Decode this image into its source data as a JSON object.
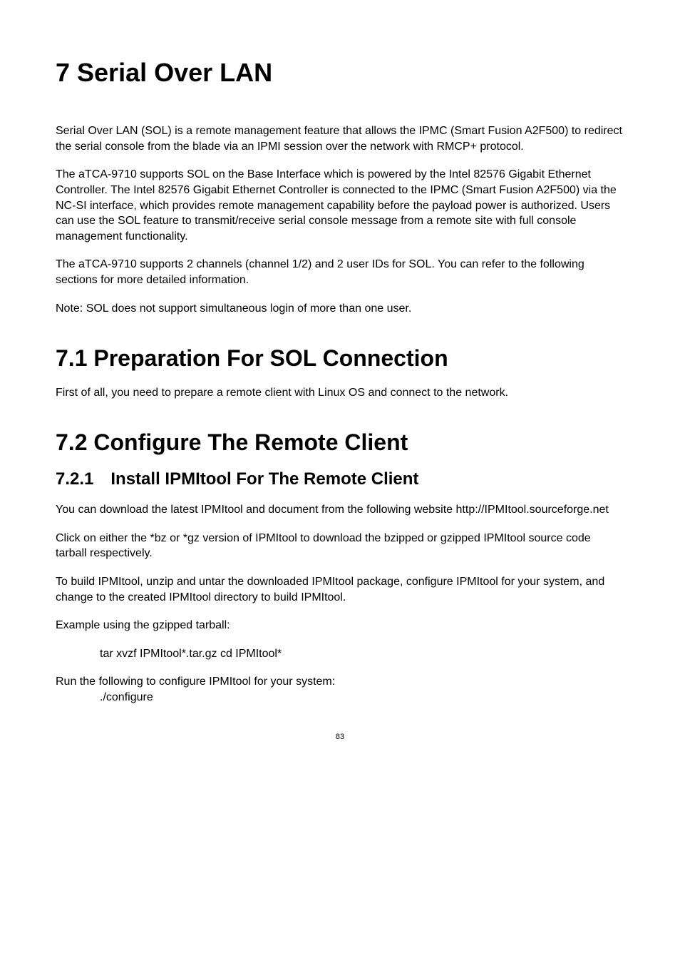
{
  "chapter": {
    "title": "7 Serial Over LAN"
  },
  "intro": {
    "p1": "Serial Over LAN (SOL) is a remote management feature that allows the IPMC (Smart Fusion A2F500) to redirect the serial console from the blade via an IPMI session over the network with RMCP+ protocol.",
    "p2": "The aTCA-9710 supports SOL on the Base Interface which is powered by the Intel 82576 Gigabit Ethernet Controller. The Intel 82576 Gigabit Ethernet Controller is connected to the IPMC (Smart Fusion A2F500) via the NC-SI interface, which provides remote management capability before the payload power is authorized. Users can use the SOL feature to transmit/receive serial console message from a remote site with full console management functionality.",
    "p3": "The aTCA-9710 supports 2 channels (channel 1/2) and 2 user IDs for SOL. You can refer to the following sections for more detailed information.",
    "p4": "Note: SOL does not support simultaneous login of more than one user."
  },
  "sec71": {
    "heading": "7.1 Preparation For SOL Connection",
    "p1": "First of all, you need to prepare a remote client with Linux OS and connect to the network."
  },
  "sec72": {
    "heading": "7.2 Configure The Remote Client",
    "sub1": {
      "heading": "7.2.1 Install IPMItool For The Remote Client",
      "p1": "You can download the latest IPMItool and document from the following website http://IPMItool.sourceforge.net",
      "p2": "Click on either the *bz or *gz version of IPMItool to download the bzipped or gzipped IPMItool source code tarball respectively.",
      "p3": "To build IPMItool, unzip and untar the downloaded IPMItool package, configure IPMItool for your system, and change to the created IPMItool directory to build IPMItool.",
      "p4": "Example using the gzipped tarball:",
      "cmd1": "tar xvzf IPMItool*.tar.gz  cd IPMItool*",
      "p5": "Run the following to configure IPMItool for your system:",
      "cmd2": "./configure"
    }
  },
  "page_number": "83"
}
